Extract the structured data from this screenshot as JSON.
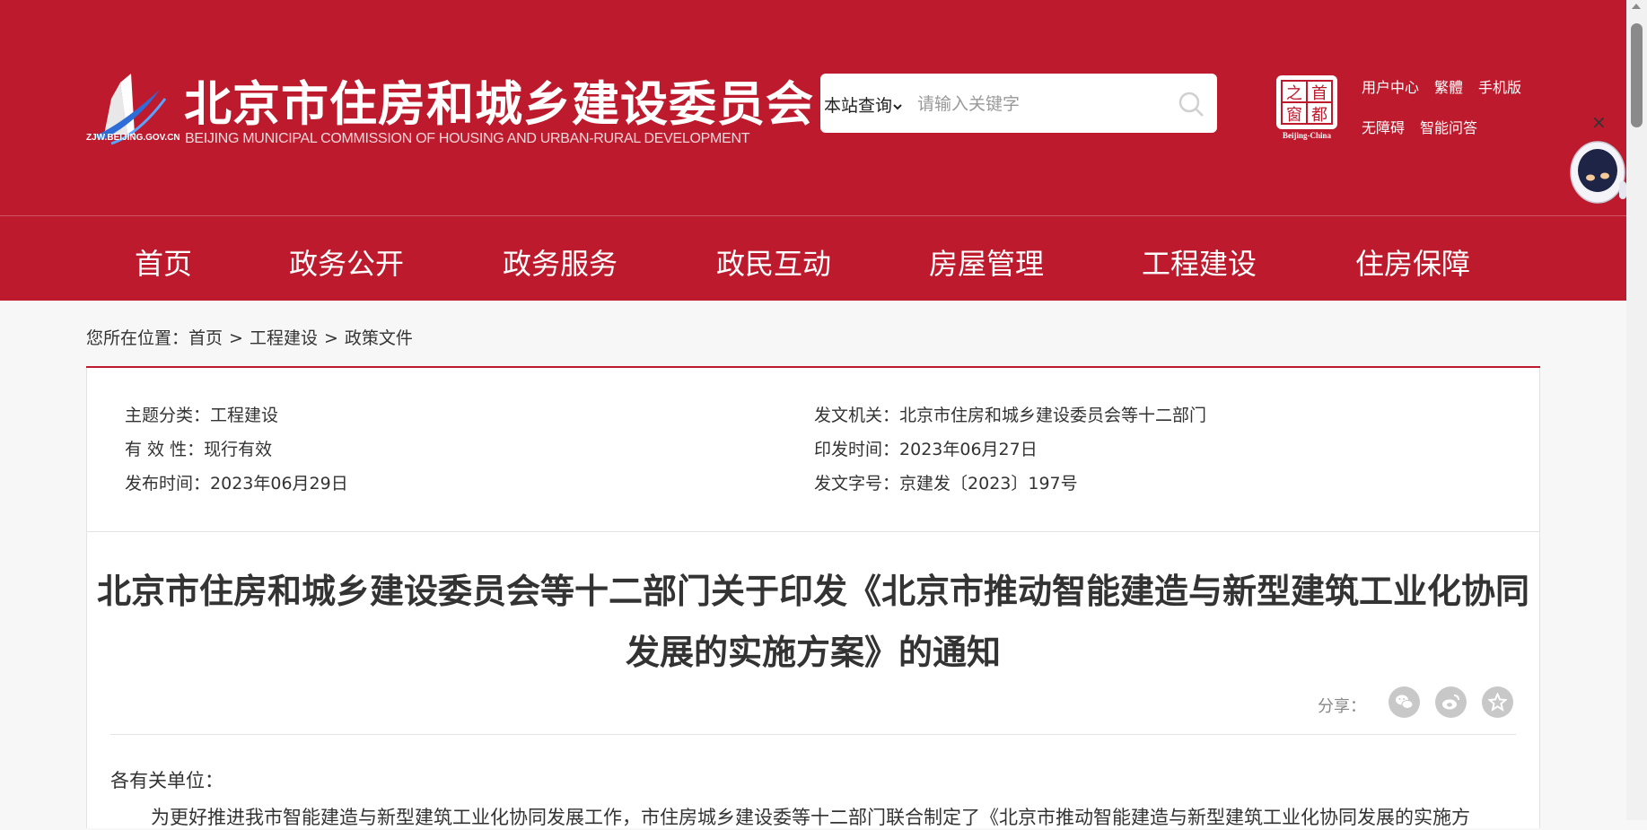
{
  "header": {
    "site_title": "北京市住房和城乡建设委员会",
    "site_subtitle": "BEIJING MUNICIPAL COMMISSION OF HOUSING AND URBAN-RURAL DEVELOPMENT",
    "domain": "ZJW.BEIJING.GOV.CN",
    "search": {
      "scope": "本站查询",
      "placeholder": "请输入关键字",
      "value": ""
    },
    "capital_logo": {
      "chars": [
        "之",
        "首",
        "窗",
        "都"
      ],
      "caption": "Beijing-China"
    },
    "links": [
      "用户中心",
      "繁體",
      "手机版",
      "无障碍",
      "智能问答"
    ]
  },
  "nav": {
    "items": [
      "首页",
      "政务公开",
      "政务服务",
      "政民互动",
      "房屋管理",
      "工程建设",
      "住房保障"
    ]
  },
  "widget": {
    "close": "×"
  },
  "breadcrumb": {
    "prefix": "您所在位置：",
    "items": [
      "首页",
      "工程建设",
      "政策文件"
    ],
    "separator": ">"
  },
  "meta": {
    "topic_label": "主题分类：",
    "topic": "工程建设",
    "validity_label": "有 效 性：",
    "validity": "现行有效",
    "publish_label": "发布时间：",
    "publish_date": "2023年06月29日",
    "issuer_label": "发文机关：",
    "issuer": "北京市住房和城乡建设委员会等十二部门",
    "print_label": "印发时间：",
    "print_date": "2023年06月27日",
    "doc_no_label": "发文字号：",
    "doc_no": "京建发〔2023〕197号"
  },
  "article": {
    "title_line1": "北京市住房和城乡建设委员会等十二部门关于印发《北京市推动智能建造与新型建筑工业化协同",
    "title_line2": "发展的实施方案》的通知",
    "share_label": "分享：",
    "salutation": "各有关单位：",
    "body_first_line": "为更好推进我市智能建造与新型建筑工业化协同发展工作，市住房城乡建设委等十二部门联合制定了《北京市推动智能建造与新型建筑工业化协同发展的实施方"
  },
  "colors": {
    "brand_red": "#bd1a2d",
    "share_icon_bg": "#c8c8c8"
  }
}
